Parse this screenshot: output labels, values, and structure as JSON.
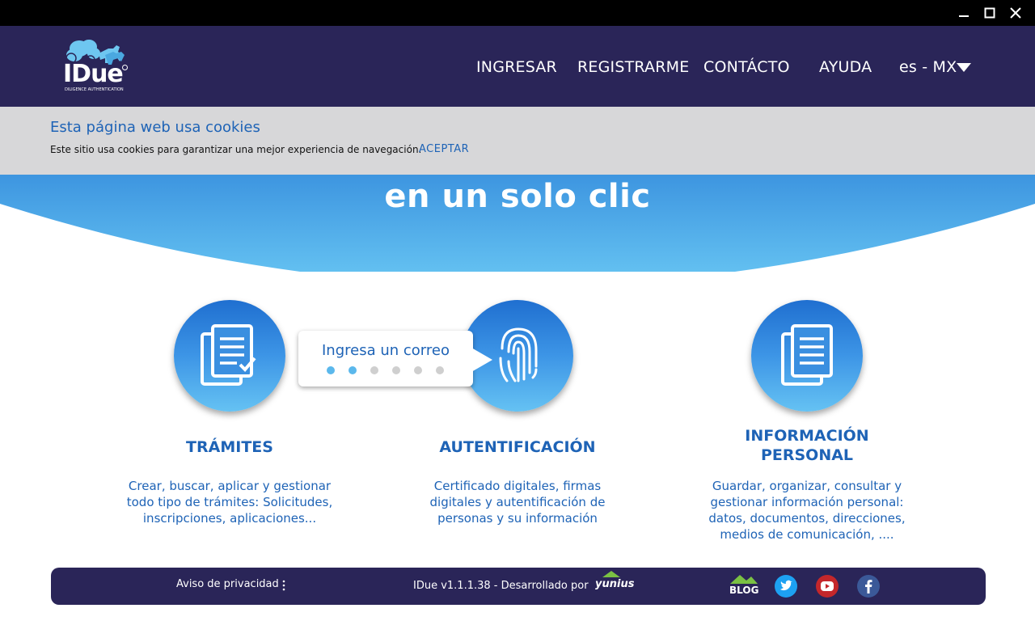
{
  "window": {
    "controls": [
      "minimize",
      "maximize",
      "close"
    ]
  },
  "header": {
    "logo_text": "IDue",
    "logo_subtext": "DILIGENCE AUTHENTICATION",
    "nav": {
      "login": "INGRESAR",
      "register": "REGISTRARME",
      "contact": "CONTÁCTO",
      "help": "AYUDA",
      "language": "es - MX"
    }
  },
  "cookie_banner": {
    "title": "Esta página web usa cookies",
    "text": "Este sitio usa cookies para garantizar una mejor experiencia de navegación.",
    "accept": "ACEPTAR"
  },
  "hero": {
    "title": "en un solo clic"
  },
  "tooltip": {
    "text": "Ingresa un correo",
    "dots_total": 6,
    "dots_active": 2,
    "active_color": "#5bb8ec",
    "inactive_color": "#cfcfcf"
  },
  "features": [
    {
      "title": "TRÁMITES",
      "desc_lines": [
        "Crear, buscar, aplicar y gestionar",
        "todo tipo de trámites: Solicitudes,",
        "inscripciones, aplicaciones..."
      ]
    },
    {
      "title": "AUTENTIFICACIÓN",
      "desc_lines": [
        "Certificado digitales, firmas",
        "digitales y autentificación de",
        "personas y su información"
      ]
    },
    {
      "title_lines": [
        "INFORMACIÓN",
        "PERSONAL"
      ],
      "desc_lines": [
        "Guardar, organizar, consultar y",
        "gestionar información personal:",
        "datos, documentos, direcciones,",
        "medios de comunicación, ...."
      ]
    }
  ],
  "footer": {
    "privacy": "Aviso de privacidad",
    "version": "IDue v1.1.1.38 - Desarrollado por",
    "developer": "yunius",
    "blog": "BLOG",
    "social": [
      "twitter",
      "youtube",
      "facebook"
    ]
  },
  "colors": {
    "header_bg": "#2a2558",
    "accent_blue": "#1e63b6",
    "cookie_bg": "#d7d7d9"
  }
}
